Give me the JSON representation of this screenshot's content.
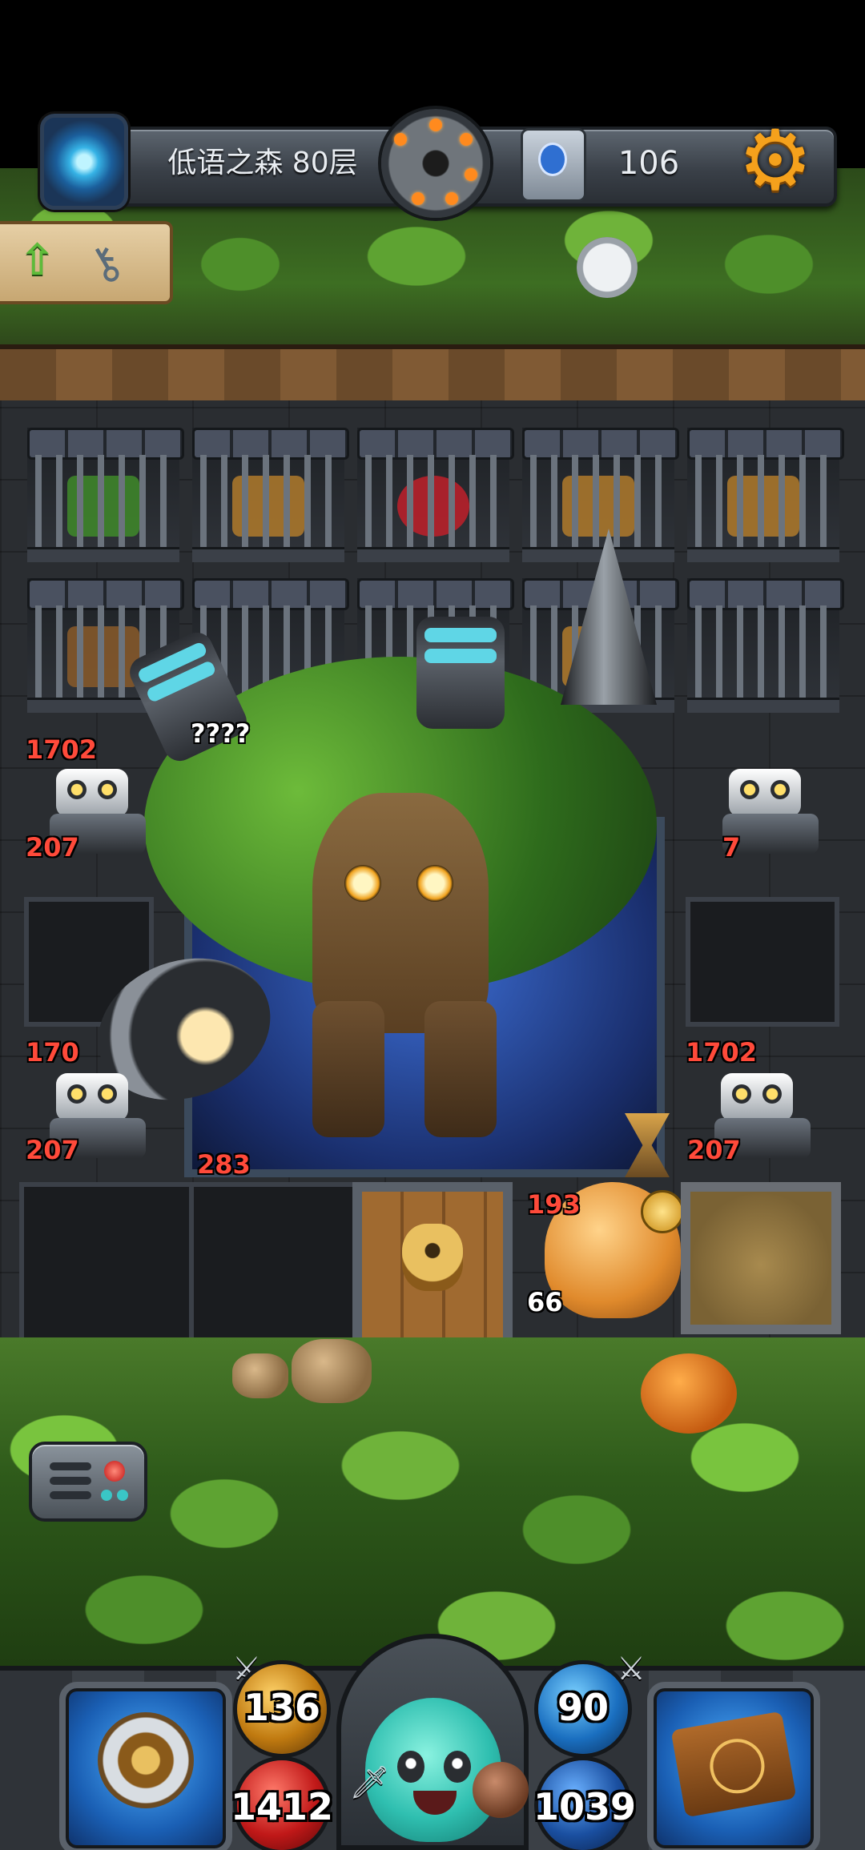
{
  "header": {
    "level_name": "低语之森 80层",
    "gem_count": "106"
  },
  "board": {
    "boss_hp": "????",
    "boss_atk": "283",
    "enemies": {
      "left_top_hp": "1702",
      "left_top_atk": "207",
      "right_top_atk": "7",
      "left_bottom_hp": "170",
      "left_bottom_atk": "207",
      "right_bottom_hp": "1702",
      "right_bottom_atk": "207"
    },
    "cat_hp": "193",
    "cat_atk": "66"
  },
  "player": {
    "attack": "136",
    "health": "1412",
    "defense": "90",
    "mana": "1039"
  },
  "icons": {
    "portal": "portal-icon",
    "bomb_dial": "bomb-dial-icon",
    "map": "map-icon",
    "settings": "gear-icon",
    "quest": "quest-scroll-icon",
    "menu": "menu-icon",
    "hero": "hero-shield-icon",
    "spellbook": "spellbook-icon"
  },
  "colors": {
    "hp_red": "#ff4a3a",
    "accent_orange": "#f5a11c",
    "slime_teal": "#2fbfb0"
  }
}
